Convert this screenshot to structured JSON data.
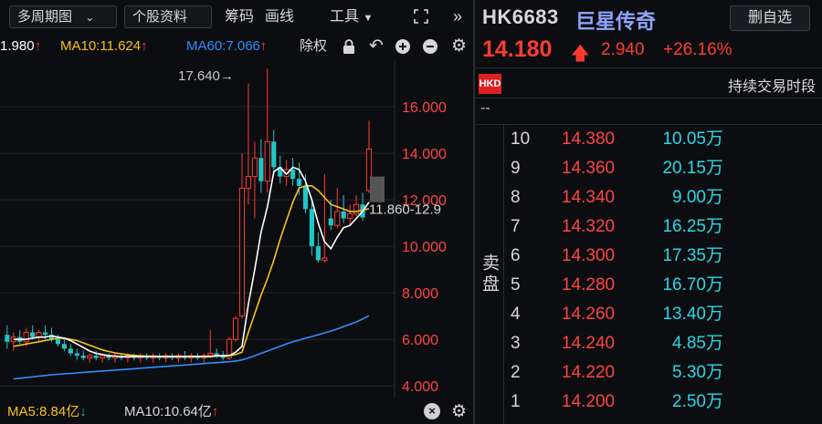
{
  "toolbar": {
    "multi_period": "多周期图",
    "stock_info": "个股资料",
    "chips": "筹码",
    "draw": "画线",
    "tools": "工具"
  },
  "ma": {
    "ma5": "1.980",
    "ma10": "MA10:11.624",
    "ma60": "MA60:7.066",
    "adjust": "除权"
  },
  "chart": {
    "high_label": "17.640→",
    "range_label": "11.860-12.9",
    "y_ticks": [
      "16.000",
      "14.000",
      "12.000",
      "10.000",
      "8.000",
      "6.000",
      "4.000"
    ],
    "colors": {
      "up": "#ff3b30",
      "down": "#22c5c5",
      "ma5": "#ffffff",
      "ma10": "#f5c518",
      "ma60": "#2f8fff"
    }
  },
  "volume": {
    "ma5": "MA5:8.84亿",
    "ma10": "MA10:10.64亿"
  },
  "quote": {
    "code": "HK6683",
    "name": "巨星传奇",
    "remove_fav": "删自选",
    "price": "14.180",
    "change": "2.940",
    "change_pct": "+26.16%",
    "currency": "HKD",
    "session": "持续交易时段",
    "dash": "--",
    "ask_label": "卖盘",
    "asks": [
      {
        "level": "10",
        "price": "14.380",
        "vol": "10.05万"
      },
      {
        "level": "9",
        "price": "14.360",
        "vol": "20.15万"
      },
      {
        "level": "8",
        "price": "14.340",
        "vol": "9.00万"
      },
      {
        "level": "7",
        "price": "14.320",
        "vol": "16.25万"
      },
      {
        "level": "6",
        "price": "14.300",
        "vol": "17.35万"
      },
      {
        "level": "5",
        "price": "14.280",
        "vol": "16.70万"
      },
      {
        "level": "4",
        "price": "14.260",
        "vol": "13.40万"
      },
      {
        "level": "3",
        "price": "14.240",
        "vol": "4.85万"
      },
      {
        "level": "2",
        "price": "14.220",
        "vol": "5.30万"
      },
      {
        "level": "1",
        "price": "14.200",
        "vol": "2.50万"
      }
    ]
  },
  "chart_data": {
    "type": "candlestick",
    "ylim": [
      3.5,
      18
    ],
    "yticks": [
      16,
      14,
      12,
      10,
      8,
      6,
      4
    ],
    "candles": [
      {
        "o": 6.2,
        "h": 6.6,
        "l": 5.6,
        "c": 5.9
      },
      {
        "o": 5.9,
        "h": 6.3,
        "l": 5.5,
        "c": 6.1
      },
      {
        "o": 6.1,
        "h": 6.4,
        "l": 5.8,
        "c": 5.9
      },
      {
        "o": 5.9,
        "h": 6.5,
        "l": 5.7,
        "c": 6.3
      },
      {
        "o": 6.3,
        "h": 6.6,
        "l": 6.0,
        "c": 6.1
      },
      {
        "o": 6.1,
        "h": 6.4,
        "l": 5.9,
        "c": 6.3
      },
      {
        "o": 6.3,
        "h": 6.6,
        "l": 6.0,
        "c": 6.2
      },
      {
        "o": 6.2,
        "h": 6.5,
        "l": 5.9,
        "c": 6.0
      },
      {
        "o": 6.0,
        "h": 6.2,
        "l": 5.7,
        "c": 5.8
      },
      {
        "o": 5.8,
        "h": 6.0,
        "l": 5.5,
        "c": 5.6
      },
      {
        "o": 5.6,
        "h": 5.8,
        "l": 5.3,
        "c": 5.4
      },
      {
        "o": 5.4,
        "h": 5.6,
        "l": 5.1,
        "c": 5.3
      },
      {
        "o": 5.3,
        "h": 5.5,
        "l": 5.1,
        "c": 5.2
      },
      {
        "o": 5.2,
        "h": 5.4,
        "l": 5.0,
        "c": 5.3
      },
      {
        "o": 5.3,
        "h": 5.5,
        "l": 5.1,
        "c": 5.2
      },
      {
        "o": 5.2,
        "h": 5.4,
        "l": 5.0,
        "c": 5.3
      },
      {
        "o": 5.3,
        "h": 5.4,
        "l": 5.1,
        "c": 5.2
      },
      {
        "o": 5.2,
        "h": 5.4,
        "l": 5.0,
        "c": 5.3
      },
      {
        "o": 5.3,
        "h": 5.4,
        "l": 5.1,
        "c": 5.2
      },
      {
        "o": 5.2,
        "h": 5.4,
        "l": 5.0,
        "c": 5.3
      },
      {
        "o": 5.3,
        "h": 5.4,
        "l": 5.1,
        "c": 5.2
      },
      {
        "o": 5.2,
        "h": 5.4,
        "l": 5.0,
        "c": 5.3
      },
      {
        "o": 5.3,
        "h": 5.4,
        "l": 5.1,
        "c": 5.2
      },
      {
        "o": 5.2,
        "h": 5.4,
        "l": 5.0,
        "c": 5.3
      },
      {
        "o": 5.3,
        "h": 5.4,
        "l": 5.1,
        "c": 5.2
      },
      {
        "o": 5.2,
        "h": 5.4,
        "l": 5.0,
        "c": 5.3
      },
      {
        "o": 5.3,
        "h": 5.4,
        "l": 5.1,
        "c": 5.2
      },
      {
        "o": 5.2,
        "h": 5.4,
        "l": 5.0,
        "c": 5.3
      },
      {
        "o": 5.3,
        "h": 5.5,
        "l": 5.1,
        "c": 5.2
      },
      {
        "o": 5.2,
        "h": 5.4,
        "l": 5.0,
        "c": 5.3
      },
      {
        "o": 5.3,
        "h": 5.4,
        "l": 5.1,
        "c": 5.2
      },
      {
        "o": 5.2,
        "h": 5.4,
        "l": 5.0,
        "c": 5.3
      },
      {
        "o": 5.3,
        "h": 6.4,
        "l": 5.2,
        "c": 5.4
      },
      {
        "o": 5.4,
        "h": 5.6,
        "l": 5.2,
        "c": 5.3
      },
      {
        "o": 5.3,
        "h": 5.5,
        "l": 5.1,
        "c": 5.2
      },
      {
        "o": 5.2,
        "h": 6.1,
        "l": 5.1,
        "c": 6.0
      },
      {
        "o": 6.0,
        "h": 7.0,
        "l": 5.9,
        "c": 6.9
      },
      {
        "o": 7.0,
        "h": 14.0,
        "l": 6.9,
        "c": 12.5
      },
      {
        "o": 12.5,
        "h": 17.0,
        "l": 11.8,
        "c": 13.0
      },
      {
        "o": 13.0,
        "h": 14.5,
        "l": 11.2,
        "c": 13.8
      },
      {
        "o": 13.8,
        "h": 14.6,
        "l": 12.3,
        "c": 12.8
      },
      {
        "o": 12.8,
        "h": 17.64,
        "l": 12.3,
        "c": 14.5
      },
      {
        "o": 14.5,
        "h": 15.0,
        "l": 13.1,
        "c": 13.4
      },
      {
        "o": 13.4,
        "h": 13.9,
        "l": 12.7,
        "c": 13.0
      },
      {
        "o": 13.0,
        "h": 13.7,
        "l": 12.6,
        "c": 13.3
      },
      {
        "o": 13.3,
        "h": 13.8,
        "l": 12.6,
        "c": 12.9
      },
      {
        "o": 12.9,
        "h": 13.6,
        "l": 12.2,
        "c": 12.6
      },
      {
        "o": 12.6,
        "h": 13.1,
        "l": 11.4,
        "c": 11.6
      },
      {
        "o": 11.6,
        "h": 12.1,
        "l": 9.6,
        "c": 10.0
      },
      {
        "o": 10.0,
        "h": 10.6,
        "l": 9.3,
        "c": 9.4
      },
      {
        "o": 9.4,
        "h": 13.1,
        "l": 9.3,
        "c": 9.5
      },
      {
        "o": 11.2,
        "h": 12.0,
        "l": 10.7,
        "c": 10.9
      },
      {
        "o": 10.9,
        "h": 12.5,
        "l": 10.8,
        "c": 11.5
      },
      {
        "o": 11.5,
        "h": 12.2,
        "l": 11.0,
        "c": 11.2
      },
      {
        "o": 11.2,
        "h": 11.8,
        "l": 10.9,
        "c": 11.4
      },
      {
        "o": 11.4,
        "h": 12.2,
        "l": 11.3,
        "c": 11.8
      },
      {
        "o": 11.8,
        "h": 12.3,
        "l": 11.1,
        "c": 11.24
      },
      {
        "o": 12.4,
        "h": 15.4,
        "l": 12.3,
        "c": 14.18
      }
    ],
    "ma5": [
      6.0,
      6.0,
      6.0,
      6.05,
      6.1,
      6.1,
      6.15,
      6.1,
      6.05,
      5.95,
      5.8,
      5.65,
      5.5,
      5.4,
      5.35,
      5.3,
      5.28,
      5.26,
      5.26,
      5.26,
      5.26,
      5.26,
      5.26,
      5.26,
      5.26,
      5.26,
      5.26,
      5.26,
      5.26,
      5.26,
      5.26,
      5.26,
      5.3,
      5.3,
      5.3,
      5.45,
      5.7,
      7.5,
      9.0,
      10.6,
      11.7,
      13.2,
      13.4,
      13.1,
      13.4,
      13.3,
      12.8,
      12.0,
      11.0,
      10.2,
      9.9,
      10.4,
      10.8,
      10.9,
      11.2,
      11.5,
      11.9
    ],
    "ma10": [
      5.7,
      5.75,
      5.8,
      5.85,
      5.9,
      5.95,
      6.0,
      6.05,
      6.05,
      6.0,
      5.95,
      5.85,
      5.75,
      5.65,
      5.55,
      5.48,
      5.42,
      5.38,
      5.34,
      5.31,
      5.29,
      5.28,
      5.27,
      5.27,
      5.27,
      5.27,
      5.27,
      5.27,
      5.27,
      5.27,
      5.27,
      5.27,
      5.28,
      5.29,
      5.3,
      5.35,
      5.45,
      6.3,
      7.1,
      7.9,
      8.6,
      9.4,
      10.3,
      11.1,
      11.9,
      12.5,
      12.6,
      12.6,
      12.4,
      12.1,
      11.8,
      11.7,
      11.6,
      11.5,
      11.5,
      11.55,
      11.62
    ],
    "ma60": [
      4.3,
      4.33,
      4.36,
      4.39,
      4.42,
      4.45,
      4.48,
      4.5,
      4.52,
      4.54,
      4.56,
      4.58,
      4.6,
      4.62,
      4.64,
      4.66,
      4.68,
      4.7,
      4.72,
      4.74,
      4.76,
      4.78,
      4.8,
      4.82,
      4.84,
      4.86,
      4.88,
      4.9,
      4.92,
      4.94,
      4.96,
      4.98,
      5.0,
      5.02,
      5.04,
      5.07,
      5.12,
      5.2,
      5.3,
      5.4,
      5.5,
      5.6,
      5.7,
      5.8,
      5.9,
      5.97,
      6.05,
      6.12,
      6.2,
      6.28,
      6.36,
      6.45,
      6.55,
      6.65,
      6.75,
      6.88,
      7.02
    ]
  }
}
